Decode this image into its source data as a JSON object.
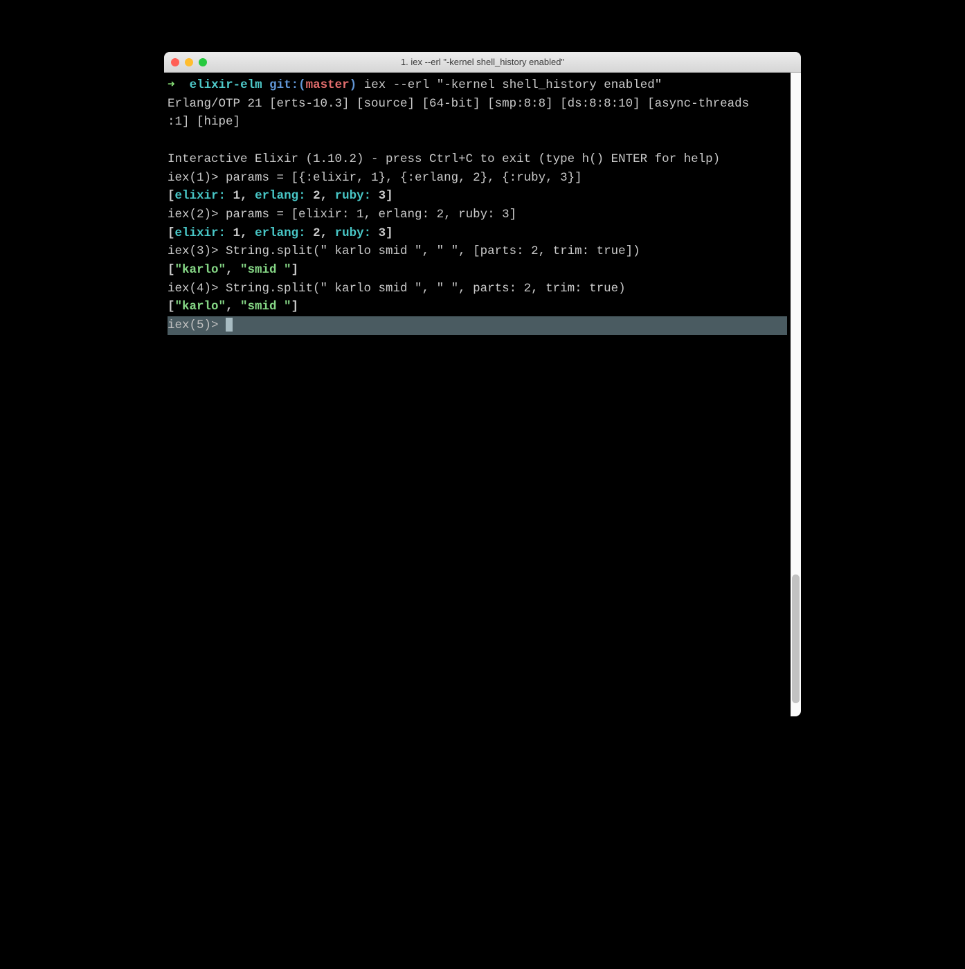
{
  "titlebar": {
    "title": "1. iex --erl \"-kernel shell_history enabled\""
  },
  "promptline": {
    "arrow": "➜",
    "cwd": "elixir-elm",
    "git_label": "git:",
    "branch": "master",
    "paren_open": "(",
    "paren_close": ")",
    "command": "iex --erl \"-kernel shell_history enabled\""
  },
  "banner": {
    "line1": "Erlang/OTP 21 [erts-10.3] [source] [64-bit] [smp:8:8] [ds:8:8:10] [async-threads:1] [hipe]",
    "blank": "",
    "info": "Interactive Elixir (1.10.2) - press Ctrl+C to exit (type h() ENTER for help)"
  },
  "iex": {
    "p1": "iex(1)>",
    "cmd1": " params = [{:elixir, 1}, {:erlang, 2}, {:ruby, 3}]",
    "out_kw": {
      "open": "[",
      "k1": "elixir:",
      "v1": " 1",
      "sep1": ", ",
      "k2": "erlang:",
      "v2": " 2",
      "sep2": ", ",
      "k3": "ruby:",
      "v3": " 3",
      "close": "]"
    },
    "p2": "iex(2)>",
    "cmd2": " params = [elixir: 1, erlang: 2, ruby: 3]",
    "p3": "iex(3)>",
    "cmd3": " String.split(\" karlo smid \", \" \", [parts: 2, trim: true])",
    "out_str": {
      "open": "[",
      "s1": "\"karlo\"",
      "sep": ", ",
      "s2": "\"smid \"",
      "close": "]"
    },
    "p4": "iex(4)>",
    "cmd4": " String.split(\" karlo smid \", \" \", parts: 2, trim: true)",
    "p5": "iex(5)> "
  }
}
